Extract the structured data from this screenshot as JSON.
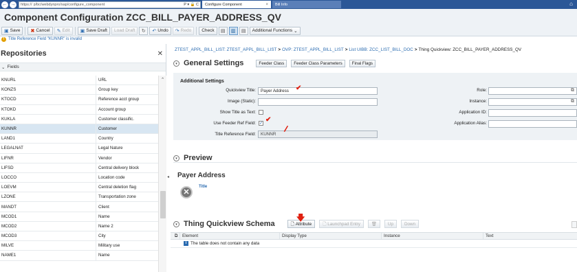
{
  "browser": {
    "url_prefix": "https://",
    "url_path": "p/bc/webdynpro/sap/configure_component",
    "url_icons": "P ▾ 🔒 C",
    "tabs": [
      {
        "label": "Configure Component",
        "close": "×"
      },
      {
        "label": "Bill Info"
      }
    ]
  },
  "app": {
    "title": "Component Configuration ZCC_BILL_PAYER_ADDRESS_QV"
  },
  "toolbar": {
    "save": "Save",
    "cancel": "Cancel",
    "edit": "Edit",
    "save_draft": "Save Draft",
    "load_draft": "Load Draft",
    "undo": "Undo",
    "redo": "Redo",
    "check": "Check",
    "additional": "Additional Functions"
  },
  "message": {
    "text": "Title Reference Field \"KUNNR\" is invalid"
  },
  "repositories": {
    "title": "Repositories",
    "close": "✕",
    "group": "Fields",
    "rows": [
      {
        "field": "KNURL",
        "desc": "URL"
      },
      {
        "field": "KONZS",
        "desc": "Group key"
      },
      {
        "field": "KTOCD",
        "desc": "Reference acct group"
      },
      {
        "field": "KTOKD",
        "desc": "Account group"
      },
      {
        "field": "KUKLA",
        "desc": "Customer classific."
      },
      {
        "field": "KUNNR",
        "desc": "Customer"
      },
      {
        "field": "LAND1",
        "desc": "Country"
      },
      {
        "field": "LEGALNAT",
        "desc": "Legal Nature"
      },
      {
        "field": "LIFNR",
        "desc": "Vendor"
      },
      {
        "field": "LIFSD",
        "desc": "Central delivery block"
      },
      {
        "field": "LOCCO",
        "desc": "Location code"
      },
      {
        "field": "LOEVM",
        "desc": "Central deletion flag"
      },
      {
        "field": "LZONE",
        "desc": "Transportation zone"
      },
      {
        "field": "MANDT",
        "desc": "Client"
      },
      {
        "field": "MCOD1",
        "desc": "Name"
      },
      {
        "field": "MCOD2",
        "desc": "Name 2"
      },
      {
        "field": "MCOD3",
        "desc": "City"
      },
      {
        "field": "MILVE",
        "desc": "Military use"
      },
      {
        "field": "NAME1",
        "desc": "Name"
      }
    ],
    "selected_index": 5
  },
  "breadcrumb": {
    "items": [
      "ZTEST_APPL_BILL_LIST: ZTEST_APPL_BILL_LIST",
      "OVP: ZTEST_APPL_BILL_LIST",
      "List UIBB: ZCC_LIST_BILL_DOC",
      "Thing Quickview: ZCC_BILL_PAYER_ADDRESS_QV"
    ],
    "separator": ">"
  },
  "general_settings": {
    "title": "General Settings",
    "buttons": [
      "Feeder Class",
      "Feeder Class Parameters",
      "Final Flags"
    ],
    "additional_title": "Additional Settings",
    "quickview_title_label": "Quickview Title:",
    "quickview_title_value": "Payer Address",
    "image_label": "Image (Static):",
    "image_value": "",
    "show_title_label": "Show Title as Text:",
    "use_feeder_label": "Use Feeder Ref Field:",
    "use_feeder_checked": true,
    "title_ref_label": "Title Reference Field:",
    "title_ref_value": "KUNNR",
    "role_label": "Role:",
    "instance_label": "Instance:",
    "app_id_label": "Application ID:",
    "app_alias_label": "Application Alias:"
  },
  "preview": {
    "title": "Preview",
    "heading": "Payer Address",
    "subtitle": "Title"
  },
  "schema": {
    "title": "Thing Quickview Schema",
    "buttons": {
      "attribute": "Attribute",
      "launchpad": "Launchpad Entry",
      "up": "Up",
      "down": "Down"
    },
    "columns": [
      "Element",
      "Display Type",
      "Instance",
      "Text"
    ],
    "empty_text": "The table does not contain any data"
  },
  "colors": {
    "accent": "#2a6bb0",
    "annotation": "#e02010",
    "warning": "#e3a000"
  }
}
